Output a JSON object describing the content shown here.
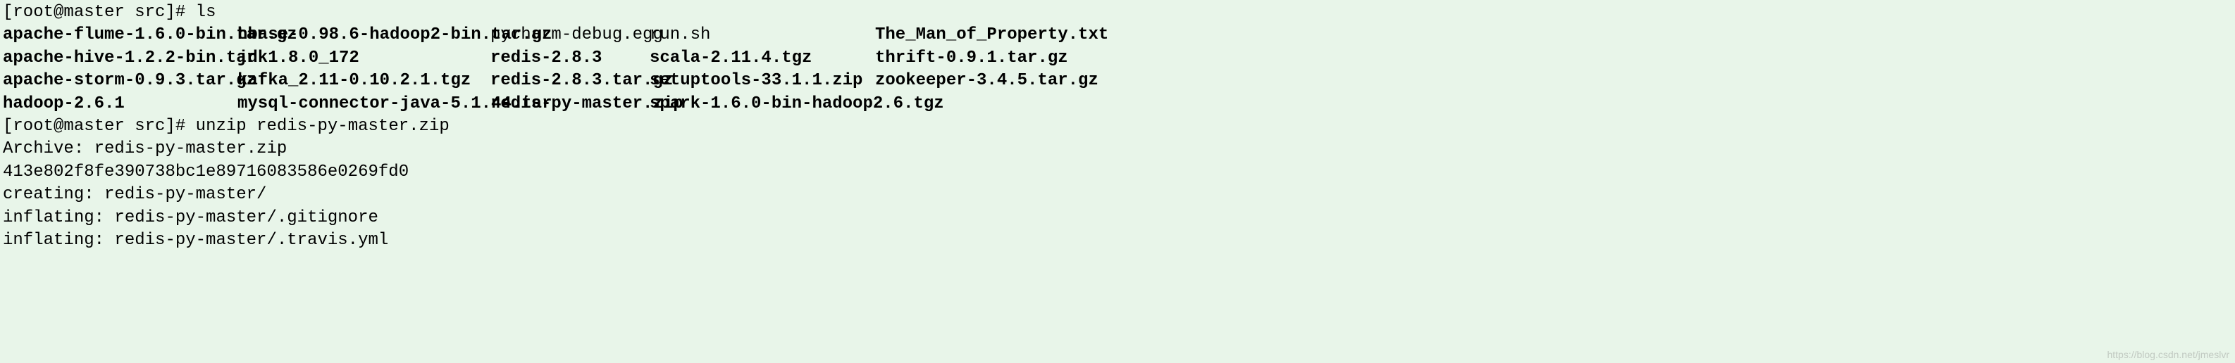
{
  "prompt1": {
    "open": "[",
    "user_host": "root@master src",
    "close": "]# ",
    "command": "ls"
  },
  "ls": {
    "row1": {
      "c1": "apache-flume-1.6.0-bin.tar.gz",
      "c2": "hbase-0.98.6-hadoop2-bin.tar.gz",
      "c3": "pycharm-debug.egg",
      "c4": "run.sh",
      "c5": "The_Man_of_Property.txt"
    },
    "row2": {
      "c1": "apache-hive-1.2.2-bin.tar",
      "c2": "jdk1.8.0_172",
      "c3": "redis-2.8.3",
      "c4": "scala-2.11.4.tgz",
      "c5": "thrift-0.9.1.tar.gz"
    },
    "row3": {
      "c1": "apache-storm-0.9.3.tar.gz",
      "c2": "kafka_2.11-0.10.2.1.tgz",
      "c3": "redis-2.8.3.tar.gz",
      "c4": "setuptools-33.1.1.zip",
      "c5": "zookeeper-3.4.5.tar.gz"
    },
    "row4": {
      "c1": "hadoop-2.6.1",
      "c2": "mysql-connector-java-5.1.44.tar",
      "c3": "redis-py-master.zip",
      "c4": "spark-1.6.0-bin-hadoop2.6.tgz",
      "c5": ""
    }
  },
  "prompt2": {
    "open": "[",
    "user_host": "root@master src",
    "close": "]# ",
    "command": "unzip redis-py-master.zip"
  },
  "output": {
    "l1": "Archive:  redis-py-master.zip",
    "l2": "413e802f8fe390738bc1e89716083586e0269fd0",
    "l3": "   creating: redis-py-master/",
    "l4": "  inflating: redis-py-master/.gitignore",
    "l5": "  inflating: redis-py-master/.travis.yml"
  },
  "watermark": "https://blog.csdn.net/jmeslvr"
}
